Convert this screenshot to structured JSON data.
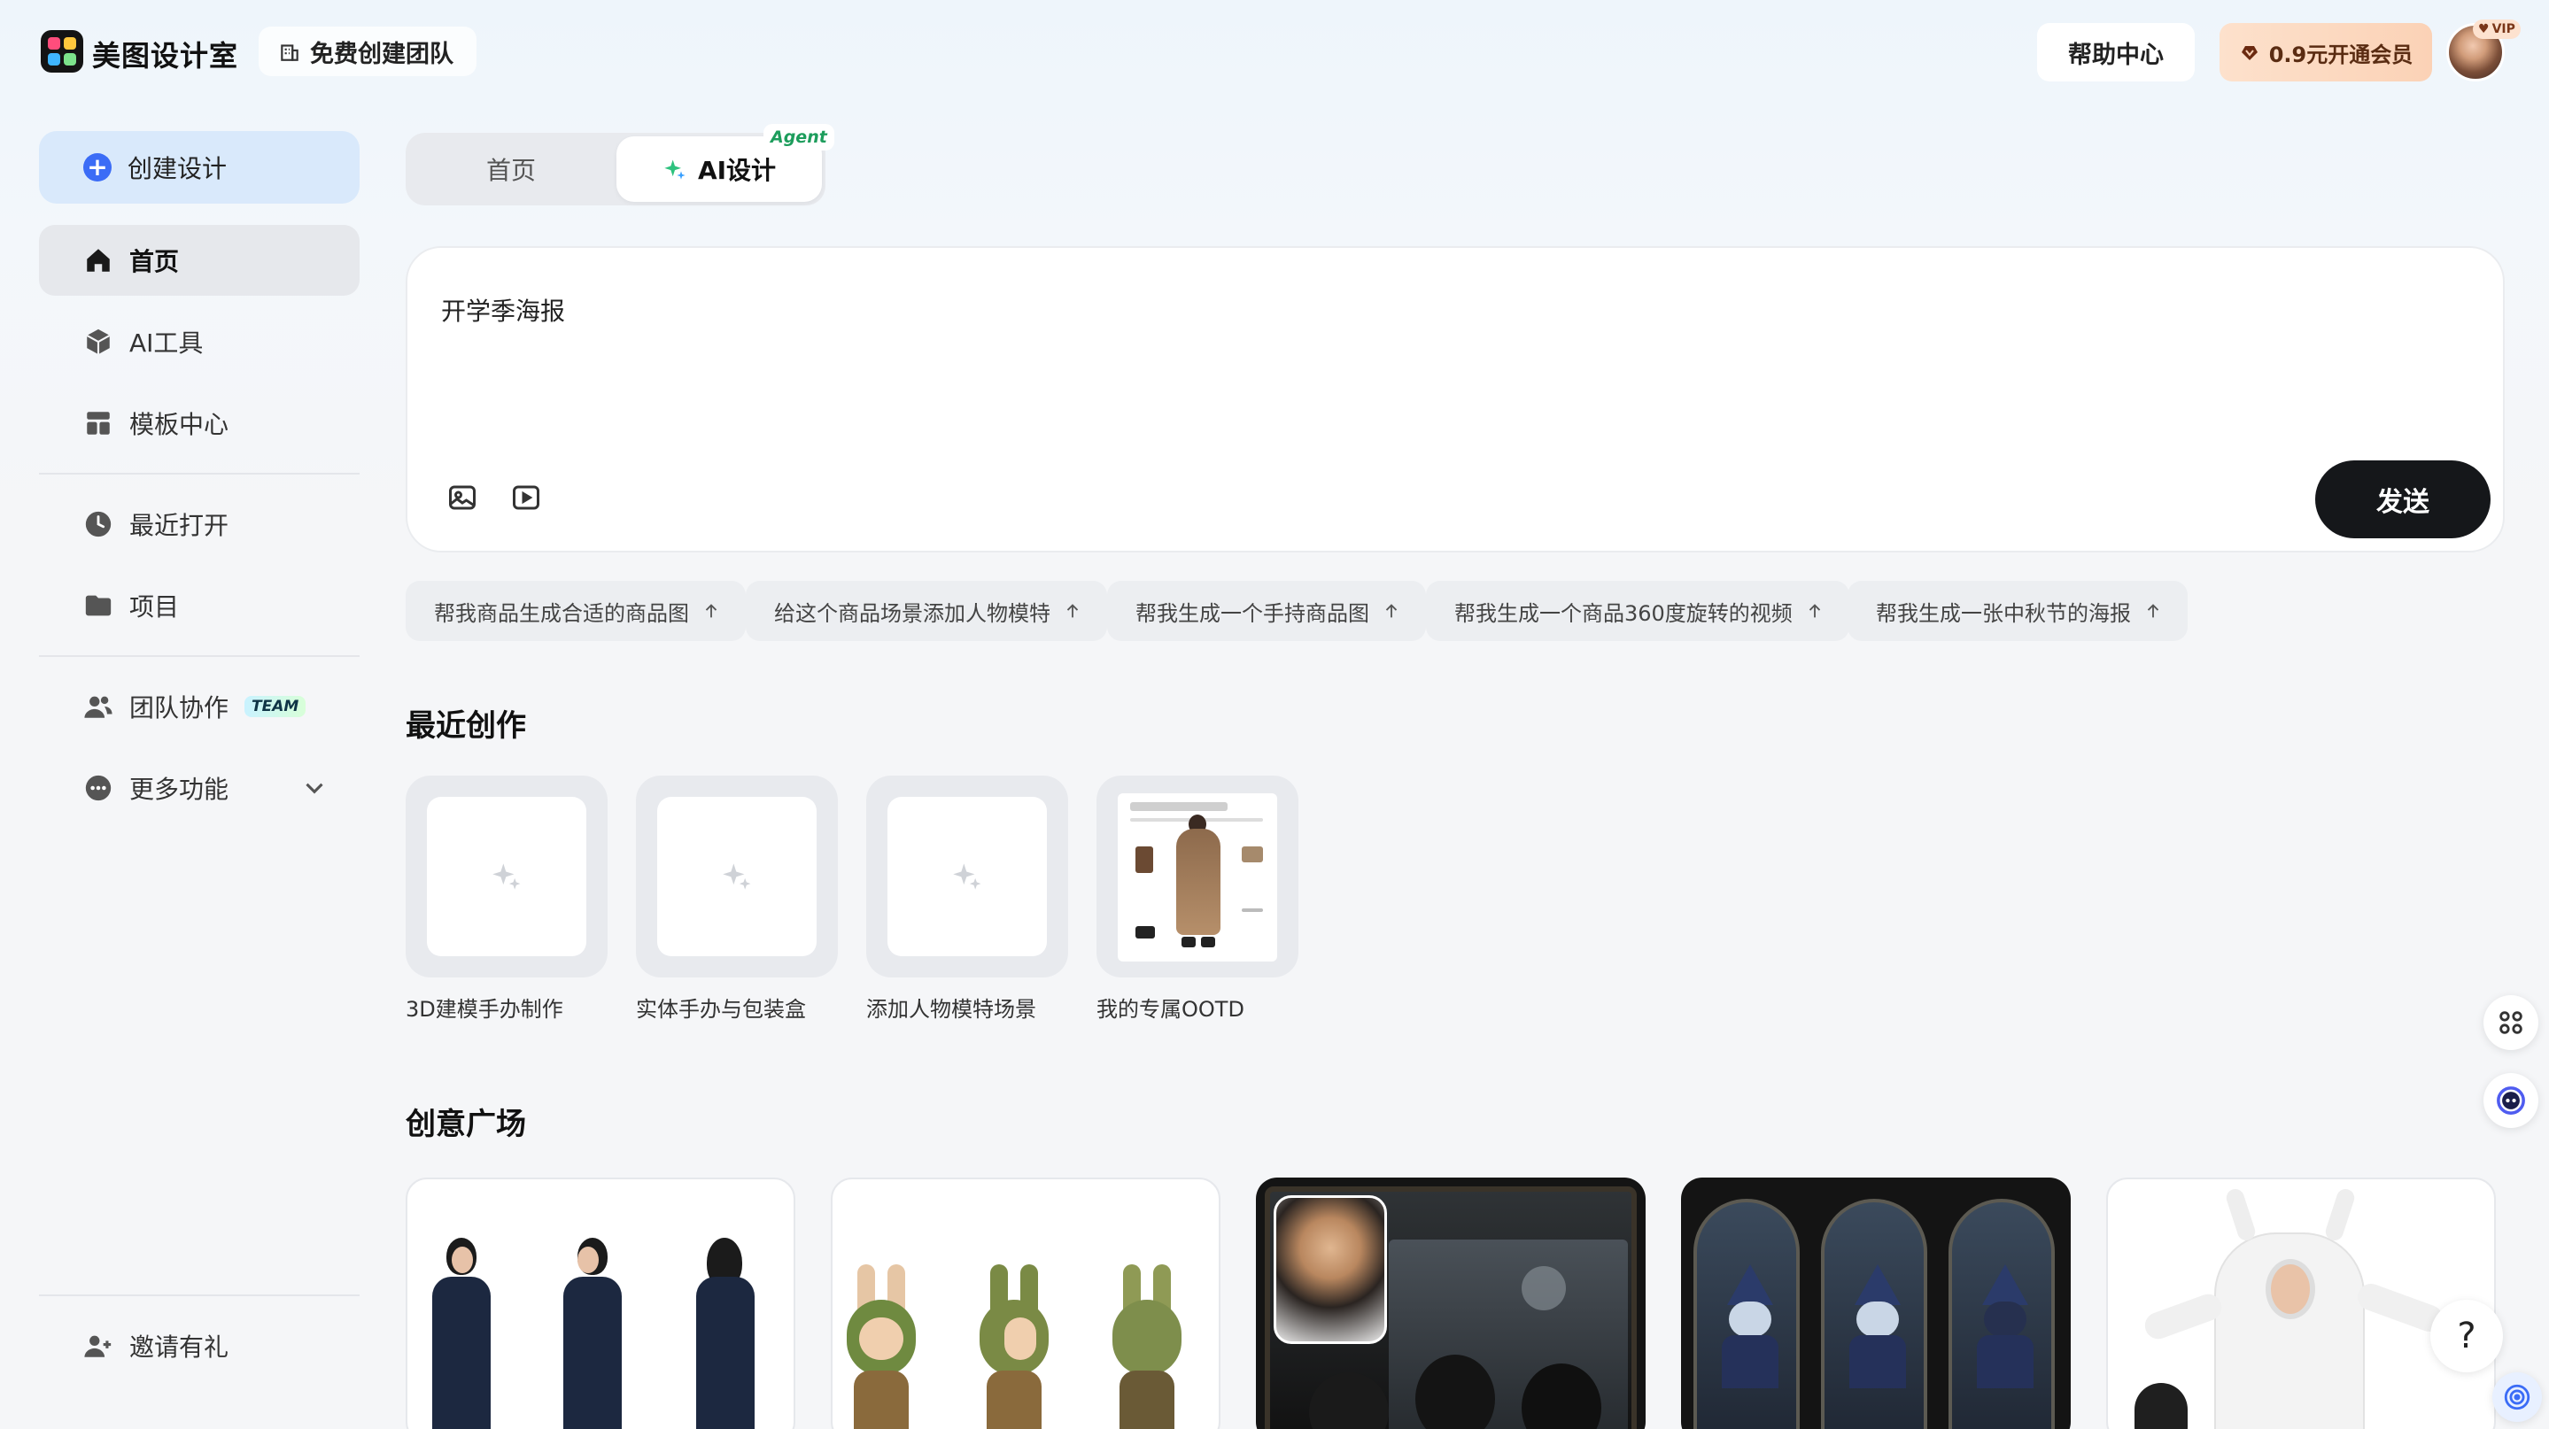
{
  "header": {
    "brand": "美图设计室",
    "team_create": "免费创建团队",
    "help": "帮助中心",
    "vip_button": "0.9元开通会员",
    "vip_tag": "VIP"
  },
  "sidebar": {
    "create": "创建设计",
    "items": [
      {
        "label": "首页"
      },
      {
        "label": "AI工具"
      },
      {
        "label": "模板中心"
      },
      {
        "label": "最近打开"
      },
      {
        "label": "项目"
      },
      {
        "label": "团队协作",
        "badge": "TEAM"
      },
      {
        "label": "更多功能"
      }
    ],
    "invite": "邀请有礼"
  },
  "tabs": {
    "home": "首页",
    "ai": "AI设计",
    "agent_tag": "Agent"
  },
  "prompt": {
    "text": "开学季海报",
    "send": "发送"
  },
  "suggestions": [
    "帮我商品生成合适的商品图",
    "给这个商品场景添加人物模特",
    "帮我生成一个手持商品图",
    "帮我生成一个商品360度旋转的视频",
    "帮我生成一张中秋节的海报"
  ],
  "recent": {
    "title": "最近创作",
    "items": [
      {
        "label": "3D建模手办制作"
      },
      {
        "label": "实体手办与包装盒"
      },
      {
        "label": "添加人物模特场景"
      },
      {
        "label": "我的专属OOTD"
      }
    ]
  },
  "gallery": {
    "title": "创意广场"
  },
  "floating": {
    "help": "?"
  },
  "colors": {
    "accent": "#3b6cf6",
    "send_bg": "#15171a",
    "vip_bg": "#fbd2b6"
  }
}
